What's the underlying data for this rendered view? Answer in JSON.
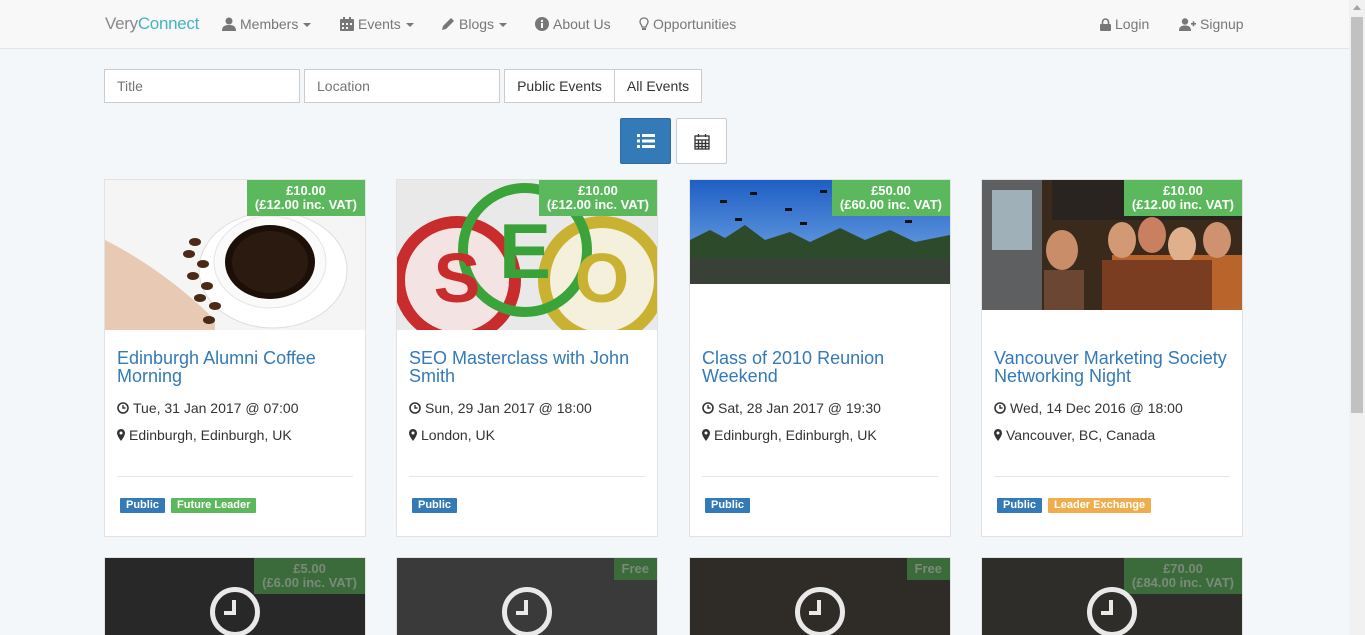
{
  "nav": {
    "brand_part1": "Very",
    "brand_part2": "Connect",
    "items": [
      {
        "label": "Members",
        "icon": "user-icon",
        "dropdown": true
      },
      {
        "label": "Events",
        "icon": "calendar-icon",
        "dropdown": true
      },
      {
        "label": "Blogs",
        "icon": "pencil-icon",
        "dropdown": true
      },
      {
        "label": "About Us",
        "icon": "info-icon",
        "dropdown": false
      },
      {
        "label": "Opportunities",
        "icon": "lightbulb-icon",
        "dropdown": false
      }
    ],
    "login": "Login",
    "signup": "Signup"
  },
  "filters": {
    "title_placeholder": "Title",
    "location_placeholder": "Location",
    "public_events": "Public Events",
    "all_events": "All Events"
  },
  "view": {
    "list_icon": "list-icon",
    "calendar_icon": "calendar-icon"
  },
  "events": [
    {
      "title": "Edinburgh Alumni Coffee Morning",
      "price": "£10.00",
      "price_vat": "(£12.00 inc. VAT)",
      "datetime": "Tue, 31 Jan 2017 @ 07:00",
      "location": "Edinburgh, Edinburgh, UK",
      "tags": [
        {
          "label": "Public",
          "color": "#337ab7"
        },
        {
          "label": "Future Leader",
          "color": "#5cb85c"
        }
      ]
    },
    {
      "title": "SEO Masterclass with John Smith",
      "price": "£10.00",
      "price_vat": "(£12.00 inc. VAT)",
      "datetime": "Sun, 29 Jan 2017 @ 18:00",
      "location": "London, UK",
      "tags": [
        {
          "label": "Public",
          "color": "#337ab7"
        }
      ],
      "image_text": [
        "S",
        "E",
        "O"
      ]
    },
    {
      "title": "Class of 2010 Reunion Weekend",
      "price": "£50.00",
      "price_vat": "(£60.00 inc. VAT)",
      "datetime": "Sat, 28 Jan 2017 @ 19:30",
      "location": "Edinburgh, Edinburgh, UK",
      "tags": [
        {
          "label": "Public",
          "color": "#337ab7"
        }
      ]
    },
    {
      "title": "Vancouver Marketing Society Networking Night",
      "price": "£10.00",
      "price_vat": "(£12.00 inc. VAT)",
      "datetime": "Wed, 14 Dec 2016 @ 18:00",
      "location": "Vancouver, BC, Canada",
      "tags": [
        {
          "label": "Public",
          "color": "#337ab7"
        },
        {
          "label": "Leader Exchange",
          "color": "#f0ad4e"
        }
      ]
    }
  ],
  "events_row2": [
    {
      "price": "£5.00",
      "price_vat": "(£6.00 inc. VAT)"
    },
    {
      "price": "Free",
      "price_vat": ""
    },
    {
      "price": "Free",
      "price_vat": ""
    },
    {
      "price": "£70.00",
      "price_vat": "(£84.00 inc. VAT)"
    }
  ]
}
